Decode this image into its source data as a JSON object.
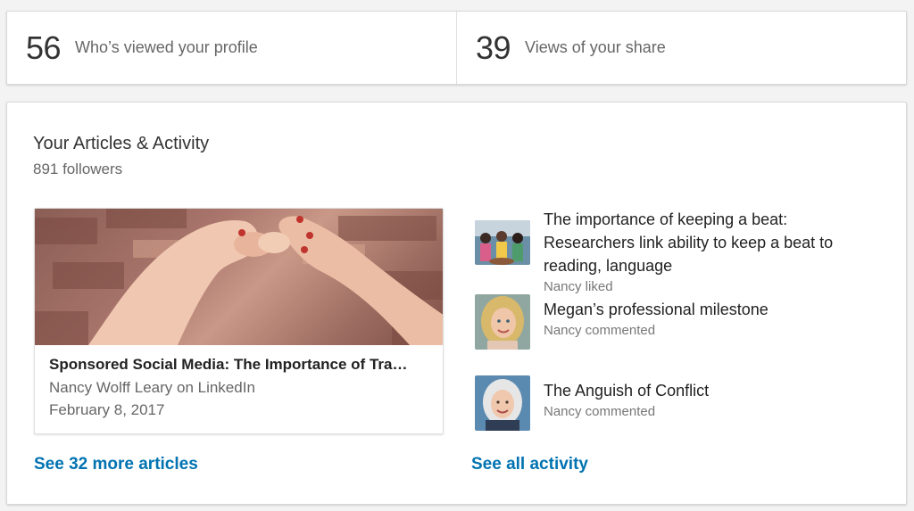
{
  "stats": [
    {
      "number": "56",
      "label": "Who’s viewed your profile"
    },
    {
      "number": "39",
      "label": "Views of your share"
    }
  ],
  "articles_section": {
    "title": "Your Articles & Activity",
    "followers": "891 followers"
  },
  "featured_article": {
    "title": "Sponsored Social Media: The Importance of Tra…",
    "author": "Nancy Wolff Leary on LinkedIn",
    "date": "February 8, 2017",
    "image_icon": "pinky-promise-hands-photo"
  },
  "activity": [
    {
      "title": "The importance of keeping a beat: Researchers link ability to keep a beat to reading, language",
      "meta": "Nancy liked",
      "thumb_icon": "kids-drumming-photo"
    },
    {
      "title": "Megan’s professional milestone",
      "meta": "Nancy commented",
      "thumb_icon": "blonde-woman-portrait"
    },
    {
      "title": "The Anguish of Conflict",
      "meta": "Nancy commented",
      "thumb_icon": "grey-haired-woman-portrait"
    }
  ],
  "links": {
    "more_articles": "See 32 more articles",
    "all_activity": "See all activity"
  },
  "colors": {
    "link": "#0073b1",
    "card_border": "#d9d9d9",
    "background": "#f3f3f3"
  }
}
